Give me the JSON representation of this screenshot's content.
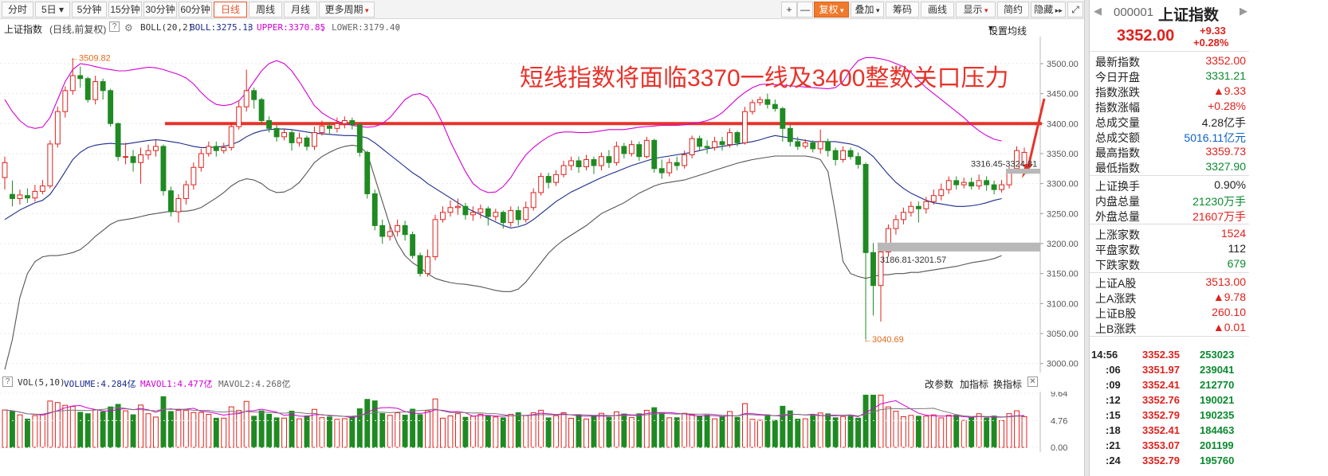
{
  "toolbar": {
    "periods": [
      "分时",
      "5日 ▾",
      "5分钟",
      "15分钟",
      "30分钟",
      "60分钟",
      "日线",
      "周线",
      "月线"
    ],
    "more_periods": "更多周期",
    "zoom_in": "+",
    "zoom_out": "—",
    "adjust": "复权",
    "overlay": "叠加",
    "chips": "筹码",
    "draw": "画线",
    "display": "显示",
    "simple": "简约",
    "hide": "隐藏"
  },
  "chart_header": {
    "name": "上证指数",
    "mode": "(日线,前复权)",
    "boll_name": "BOLL(20,2)",
    "boll": "BOLL:3275.13",
    "upper": "UPPER:3370.85",
    "lower": "LOWER:3179.40",
    "set_ma": "设置均线"
  },
  "annotation": {
    "headline": "短线指数将面临3370一线及3400整数关口压力",
    "high_label": "←3509.82",
    "low_label": "←3040.69",
    "gap_upper_label": "3316.45-3324.81",
    "gap_lower_label": "3186.81-3201.57"
  },
  "colors": {
    "up": "#e0211c",
    "down": "#1f8a22",
    "boll": "#1a2a8c",
    "upper": "#d400d4",
    "lower": "#555555",
    "annotation": "#e8332a"
  },
  "chart_data": {
    "type": "candlestick",
    "y_axis_ticks": [
      3500,
      3450,
      3400,
      3350,
      3300,
      3250,
      3200,
      3150,
      3100,
      3050,
      3000
    ],
    "ylim": [
      2985,
      3545
    ],
    "resistance_level": 3400,
    "candles": [
      [
        3310,
        3335,
        3345,
        3290
      ],
      [
        3282,
        3275,
        3305,
        3262
      ],
      [
        3275,
        3281,
        3290,
        3265
      ],
      [
        3280,
        3276,
        3292,
        3268
      ],
      [
        3276,
        3287,
        3298,
        3270
      ],
      [
        3287,
        3296,
        3306,
        3282
      ],
      [
        3296,
        3366,
        3372,
        3292
      ],
      [
        3366,
        3420,
        3428,
        3360
      ],
      [
        3420,
        3455,
        3462,
        3410
      ],
      [
        3455,
        3480,
        3509,
        3448
      ],
      [
        3480,
        3475,
        3495,
        3460
      ],
      [
        3475,
        3440,
        3478,
        3435
      ],
      [
        3440,
        3470,
        3480,
        3432
      ],
      [
        3470,
        3455,
        3475,
        3440
      ],
      [
        3455,
        3400,
        3458,
        3395
      ],
      [
        3400,
        3345,
        3402,
        3338
      ],
      [
        3345,
        3345,
        3368,
        3332
      ],
      [
        3345,
        3335,
        3356,
        3320
      ],
      [
        3335,
        3348,
        3360,
        3300
      ],
      [
        3348,
        3355,
        3365,
        3340
      ],
      [
        3355,
        3362,
        3372,
        3345
      ],
      [
        3362,
        3288,
        3365,
        3280
      ],
      [
        3288,
        3253,
        3295,
        3245
      ],
      [
        3253,
        3275,
        3282,
        3235
      ],
      [
        3275,
        3298,
        3305,
        3265
      ],
      [
        3298,
        3327,
        3335,
        3290
      ],
      [
        3327,
        3350,
        3358,
        3320
      ],
      [
        3350,
        3362,
        3370,
        3345
      ],
      [
        3362,
        3355,
        3370,
        3345
      ],
      [
        3355,
        3360,
        3368,
        3350
      ],
      [
        3360,
        3395,
        3402,
        3355
      ],
      [
        3395,
        3428,
        3438,
        3390
      ],
      [
        3428,
        3455,
        3490,
        3420
      ],
      [
        3455,
        3440,
        3460,
        3425
      ],
      [
        3440,
        3405,
        3443,
        3398
      ],
      [
        3405,
        3392,
        3412,
        3385
      ],
      [
        3392,
        3378,
        3398,
        3370
      ],
      [
        3378,
        3385,
        3392,
        3372
      ],
      [
        3385,
        3368,
        3390,
        3355
      ],
      [
        3368,
        3376,
        3385,
        3362
      ],
      [
        3376,
        3362,
        3380,
        3355
      ],
      [
        3362,
        3385,
        3395,
        3356
      ],
      [
        3385,
        3396,
        3405,
        3380
      ],
      [
        3396,
        3392,
        3402,
        3382
      ],
      [
        3392,
        3400,
        3410,
        3385
      ],
      [
        3400,
        3405,
        3412,
        3392
      ],
      [
        3405,
        3398,
        3410,
        3390
      ],
      [
        3398,
        3352,
        3402,
        3345
      ],
      [
        3352,
        3283,
        3355,
        3275
      ],
      [
        3283,
        3230,
        3290,
        3222
      ],
      [
        3230,
        3212,
        3240,
        3200
      ],
      [
        3212,
        3220,
        3232,
        3205
      ],
      [
        3220,
        3230,
        3240,
        3212
      ],
      [
        3230,
        3215,
        3238,
        3205
      ],
      [
        3215,
        3180,
        3220,
        3175
      ],
      [
        3180,
        3150,
        3185,
        3145
      ],
      [
        3150,
        3178,
        3190,
        3145
      ],
      [
        3178,
        3240,
        3248,
        3172
      ],
      [
        3240,
        3252,
        3262,
        3235
      ],
      [
        3252,
        3260,
        3272,
        3245
      ],
      [
        3260,
        3262,
        3275,
        3248
      ],
      [
        3262,
        3248,
        3268,
        3240
      ],
      [
        3248,
        3252,
        3262,
        3238
      ],
      [
        3252,
        3258,
        3265,
        3242
      ],
      [
        3258,
        3245,
        3262,
        3230
      ],
      [
        3245,
        3252,
        3258,
        3238
      ],
      [
        3252,
        3235,
        3255,
        3225
      ],
      [
        3235,
        3255,
        3262,
        3228
      ],
      [
        3255,
        3240,
        3262,
        3230
      ],
      [
        3240,
        3260,
        3270,
        3235
      ],
      [
        3260,
        3285,
        3292,
        3255
      ],
      [
        3285,
        3312,
        3318,
        3280
      ],
      [
        3312,
        3302,
        3318,
        3292
      ],
      [
        3302,
        3315,
        3322,
        3296
      ],
      [
        3315,
        3330,
        3338,
        3310
      ],
      [
        3330,
        3338,
        3345,
        3322
      ],
      [
        3338,
        3328,
        3345,
        3318
      ],
      [
        3328,
        3340,
        3348,
        3322
      ],
      [
        3340,
        3330,
        3345,
        3316
      ],
      [
        3330,
        3345,
        3352,
        3322
      ],
      [
        3345,
        3335,
        3356,
        3326
      ],
      [
        3335,
        3362,
        3370,
        3330
      ],
      [
        3362,
        3350,
        3368,
        3342
      ],
      [
        3350,
        3365,
        3372,
        3345
      ],
      [
        3365,
        3345,
        3370,
        3338
      ],
      [
        3345,
        3372,
        3378,
        3342
      ],
      [
        3372,
        3325,
        3375,
        3318
      ],
      [
        3325,
        3318,
        3340,
        3308
      ],
      [
        3318,
        3335,
        3342,
        3312
      ],
      [
        3335,
        3330,
        3345,
        3322
      ],
      [
        3330,
        3348,
        3355,
        3325
      ],
      [
        3348,
        3375,
        3380,
        3342
      ],
      [
        3375,
        3362,
        3380,
        3355
      ],
      [
        3362,
        3360,
        3372,
        3350
      ],
      [
        3360,
        3370,
        3378,
        3355
      ],
      [
        3370,
        3365,
        3378,
        3355
      ],
      [
        3365,
        3385,
        3392,
        3360
      ],
      [
        3385,
        3368,
        3388,
        3362
      ],
      [
        3368,
        3420,
        3428,
        3365
      ],
      [
        3420,
        3435,
        3440,
        3415
      ],
      [
        3435,
        3440,
        3445,
        3430
      ],
      [
        3440,
        3432,
        3450,
        3425
      ],
      [
        3432,
        3425,
        3440,
        3420
      ],
      [
        3425,
        3392,
        3428,
        3370
      ],
      [
        3392,
        3370,
        3398,
        3362
      ],
      [
        3370,
        3362,
        3378,
        3356
      ],
      [
        3362,
        3368,
        3374,
        3358
      ],
      [
        3368,
        3358,
        3372,
        3352
      ],
      [
        3358,
        3370,
        3390,
        3350
      ],
      [
        3370,
        3355,
        3375,
        3345
      ],
      [
        3355,
        3340,
        3360,
        3330
      ],
      [
        3340,
        3355,
        3362,
        3335
      ],
      [
        3355,
        3345,
        3360,
        3340
      ],
      [
        3345,
        3332,
        3352,
        3325
      ],
      [
        3332,
        3185,
        3335,
        3040
      ],
      [
        3185,
        3130,
        3201,
        3080
      ],
      [
        3130,
        3186,
        3195,
        3070
      ],
      [
        3186,
        3225,
        3232,
        3178
      ],
      [
        3225,
        3240,
        3248,
        3215
      ],
      [
        3240,
        3252,
        3260,
        3232
      ],
      [
        3252,
        3262,
        3270,
        3245
      ],
      [
        3262,
        3258,
        3270,
        3235
      ],
      [
        3258,
        3270,
        3278,
        3250
      ],
      [
        3270,
        3280,
        3290,
        3265
      ],
      [
        3280,
        3290,
        3300,
        3272
      ],
      [
        3290,
        3305,
        3312,
        3283
      ],
      [
        3305,
        3298,
        3312,
        3290
      ],
      [
        3298,
        3302,
        3310,
        3292
      ],
      [
        3302,
        3296,
        3310,
        3290
      ],
      [
        3296,
        3305,
        3315,
        3290
      ],
      [
        3305,
        3298,
        3312,
        3288
      ],
      [
        3298,
        3290,
        3305,
        3282
      ],
      [
        3290,
        3298,
        3306,
        3285
      ],
      [
        3298,
        3322,
        3328,
        3292
      ],
      [
        3325,
        3355,
        3362,
        3324
      ],
      [
        3331,
        3352,
        3360,
        3328
      ]
    ],
    "boll_mid": [
      3240,
      3248,
      3256,
      3262,
      3268,
      3272,
      3282,
      3300,
      3320,
      3340,
      3352,
      3360,
      3364,
      3366,
      3367,
      3366,
      3366,
      3368,
      3370,
      3372,
      3373,
      3372,
      3370,
      3368,
      3365,
      3362,
      3360,
      3360,
      3361,
      3362,
      3365,
      3370,
      3378,
      3384,
      3388,
      3390,
      3391,
      3391,
      3390,
      3388,
      3386,
      3384,
      3383,
      3382,
      3381,
      3380,
      3380,
      3379,
      3376,
      3368,
      3358,
      3348,
      3338,
      3328,
      3318,
      3310,
      3300,
      3292,
      3284,
      3276,
      3268,
      3260,
      3254,
      3248,
      3242,
      3236,
      3230,
      3226,
      3228,
      3232,
      3240,
      3250,
      3260,
      3270,
      3278,
      3286,
      3292,
      3298,
      3304,
      3310,
      3315,
      3320,
      3325,
      3330,
      3334,
      3338,
      3342,
      3344,
      3346,
      3348,
      3350,
      3352,
      3355,
      3358,
      3360,
      3362,
      3364,
      3366,
      3368,
      3370,
      3373,
      3377,
      3380,
      3378,
      3376,
      3374,
      3372,
      3370,
      3370,
      3370,
      3370,
      3368,
      3366,
      3362,
      3355,
      3345,
      3330,
      3315,
      3302,
      3292,
      3284,
      3278,
      3272,
      3268,
      3266,
      3264,
      3262,
      3262,
      3263,
      3265,
      3268,
      3272,
      3275
    ],
    "boll_upper": [
      3440,
      3420,
      3405,
      3395,
      3392,
      3394,
      3410,
      3440,
      3470,
      3490,
      3500,
      3498,
      3495,
      3492,
      3490,
      3488,
      3488,
      3490,
      3492,
      3494,
      3493,
      3490,
      3486,
      3482,
      3476,
      3466,
      3452,
      3440,
      3432,
      3430,
      3432,
      3438,
      3452,
      3470,
      3488,
      3500,
      3505,
      3500,
      3488,
      3470,
      3450,
      3430,
      3418,
      3410,
      3404,
      3400,
      3397,
      3395,
      3394,
      3395,
      3400,
      3410,
      3425,
      3440,
      3448,
      3450,
      3444,
      3425,
      3400,
      3370,
      3345,
      3320,
      3300,
      3290,
      3285,
      3286,
      3295,
      3310,
      3330,
      3348,
      3360,
      3370,
      3378,
      3384,
      3386,
      3386,
      3385,
      3385,
      3386,
      3388,
      3390,
      3390,
      3390,
      3392,
      3394,
      3395,
      3396,
      3397,
      3397,
      3397,
      3398,
      3400,
      3402,
      3405,
      3410,
      3418,
      3430,
      3442,
      3452,
      3460,
      3465,
      3466,
      3465,
      3464,
      3463,
      3462,
      3461,
      3460,
      3459,
      3458,
      3460,
      3470,
      3490,
      3505,
      3510,
      3510,
      3508,
      3505,
      3500,
      3495,
      3485,
      3472,
      3460,
      3450,
      3440,
      3430,
      3420,
      3410,
      3398,
      3388,
      3380,
      3374,
      3371
    ],
    "boll_lower": [
      2990,
      3040,
      3110,
      3150,
      3170,
      3178,
      3180,
      3180,
      3182,
      3185,
      3190,
      3200,
      3212,
      3222,
      3232,
      3238,
      3240,
      3242,
      3245,
      3248,
      3250,
      3252,
      3254,
      3254,
      3254,
      3256,
      3260,
      3268,
      3276,
      3285,
      3296,
      3304,
      3308,
      3306,
      3300,
      3290,
      3285,
      3286,
      3292,
      3302,
      3318,
      3335,
      3345,
      3352,
      3358,
      3362,
      3364,
      3362,
      3350,
      3310,
      3270,
      3230,
      3200,
      3180,
      3168,
      3160,
      3150,
      3142,
      3138,
      3135,
      3133,
      3132,
      3130,
      3128,
      3125,
      3122,
      3120,
      3120,
      3124,
      3136,
      3152,
      3168,
      3184,
      3196,
      3206,
      3214,
      3222,
      3230,
      3240,
      3250,
      3256,
      3262,
      3268,
      3276,
      3284,
      3290,
      3296,
      3300,
      3302,
      3304,
      3306,
      3310,
      3314,
      3318,
      3322,
      3326,
      3330,
      3334,
      3337,
      3340,
      3342,
      3344,
      3346,
      3346,
      3346,
      3346,
      3346,
      3344,
      3340,
      3320,
      3250,
      3170,
      3150,
      3145,
      3142,
      3145,
      3148,
      3148,
      3150,
      3150,
      3152,
      3152,
      3154,
      3156,
      3158,
      3160,
      3162,
      3165,
      3168,
      3170,
      3172,
      3175,
      3180
    ]
  },
  "volume": {
    "name": "VOL(5,10)",
    "volume": "VOLUME:4.284亿",
    "mavol1": "MAVOL1:4.477亿",
    "mavol2": "MAVOL2:4.268亿",
    "change_params": "改参数",
    "add_indicator": "加指标",
    "switch_indicator": "换指标",
    "axis_ticks": [
      "9.64",
      "4.76",
      "0.00"
    ],
    "ylim": [
      0,
      9.64
    ]
  },
  "quote": {
    "code": "000001",
    "name": "上证指数",
    "last": "3352.00",
    "change": "+9.33",
    "change_pct": "+0.28%",
    "stats": [
      {
        "label": "最新指数",
        "value": "3352.00",
        "color": "red"
      },
      {
        "label": "今日开盘",
        "value": "3331.21",
        "color": "green"
      },
      {
        "label": "指数涨跌",
        "value": "▲9.33",
        "color": "red"
      },
      {
        "label": "指数涨幅",
        "value": "+0.28%",
        "color": "red"
      },
      {
        "label": "总成交量",
        "value": "4.28亿手",
        "color": "blk"
      },
      {
        "label": "总成交额",
        "value": "5016.11亿元",
        "color": "blue"
      },
      {
        "label": "最高指数",
        "value": "3359.73",
        "color": "red"
      },
      {
        "label": "最低指数",
        "value": "3327.90",
        "color": "green"
      },
      {
        "label": "上证换手",
        "value": "0.90%",
        "color": "blk"
      },
      {
        "label": "内盘总量",
        "value": "21230万手",
        "color": "green"
      },
      {
        "label": "外盘总量",
        "value": "21607万手",
        "color": "red"
      },
      {
        "label": "上涨家数",
        "value": "1524",
        "color": "red"
      },
      {
        "label": "平盘家数",
        "value": "112",
        "color": "blk"
      },
      {
        "label": "下跌家数",
        "value": "679",
        "color": "green"
      },
      {
        "label": "上证A股",
        "value": "3513.00",
        "color": "red"
      },
      {
        "label": "上A涨跌",
        "value": "▲9.78",
        "color": "red"
      },
      {
        "label": "上证B股",
        "value": "260.10",
        "color": "red"
      },
      {
        "label": "上B涨跌",
        "value": "▲0.01",
        "color": "red"
      }
    ],
    "ticks": [
      {
        "time": "14:56",
        "price": "3352.35",
        "vol": "253023"
      },
      {
        "time": ":06",
        "price": "3351.97",
        "vol": "239041"
      },
      {
        "time": ":09",
        "price": "3352.41",
        "vol": "212770"
      },
      {
        "time": ":12",
        "price": "3352.76",
        "vol": "190021"
      },
      {
        "time": ":15",
        "price": "3352.79",
        "vol": "190235"
      },
      {
        "time": ":18",
        "price": "3352.41",
        "vol": "184463"
      },
      {
        "time": ":21",
        "price": "3353.07",
        "vol": "201199"
      },
      {
        "time": ":24",
        "price": "3352.79",
        "vol": "195760"
      }
    ]
  }
}
